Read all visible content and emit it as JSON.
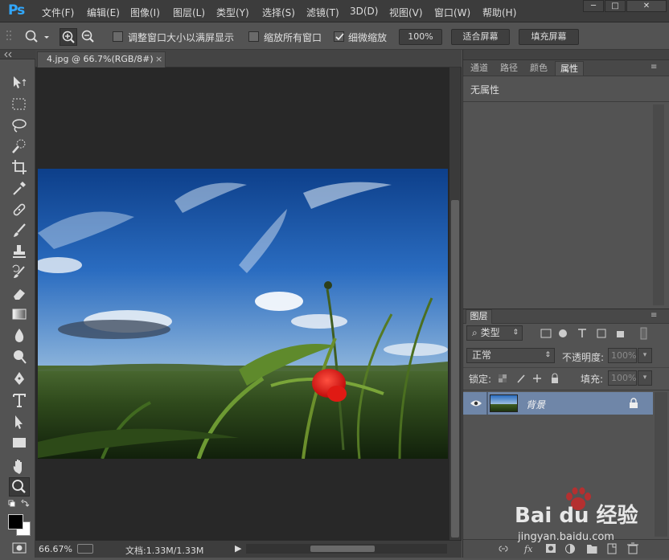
{
  "app": {
    "logo": "Ps"
  },
  "menu": [
    "文件(F)",
    "编辑(E)",
    "图像(I)",
    "图层(L)",
    "类型(Y)",
    "选择(S)",
    "滤镜(T)",
    "3D(D)",
    "视图(V)",
    "窗口(W)",
    "帮助(H)"
  ],
  "window_controls": [
    "─",
    "□",
    "✕"
  ],
  "options": {
    "resize_windows": "调整窗口大小以满屏显示",
    "zoom_all": "缩放所有窗口",
    "scrubby_zoom": "细微缩放",
    "scrubby_checked": true,
    "percent_btn": "100%",
    "fit_btn": "适合屏幕",
    "fill_btn": "填充屏幕"
  },
  "document": {
    "tab_title": "4.jpg @ 66.7%(RGB/8#)",
    "tab_close": "×"
  },
  "status": {
    "zoom": "66.67%",
    "doc_info": "文档:1.33M/1.33M",
    "arrow": "▶"
  },
  "panels": {
    "tabs": [
      "通道",
      "路径",
      "颜色",
      "属性"
    ],
    "active_tab": "属性",
    "properties_text": "无属性"
  },
  "layers": {
    "tab": "图层",
    "filter_kind": "类型",
    "blend_mode": "正常",
    "opacity_label": "不透明度:",
    "opacity_value": "100%",
    "lock_label": "锁定:",
    "fill_label": "填充:",
    "fill_value": "100%",
    "layer_name": "背景"
  },
  "watermark": {
    "brand": "Bai du 经验",
    "url": "jingyan.baidu.com"
  },
  "colors": {
    "accent": "#31a8ff",
    "selected_layer": "#6f86a8"
  }
}
